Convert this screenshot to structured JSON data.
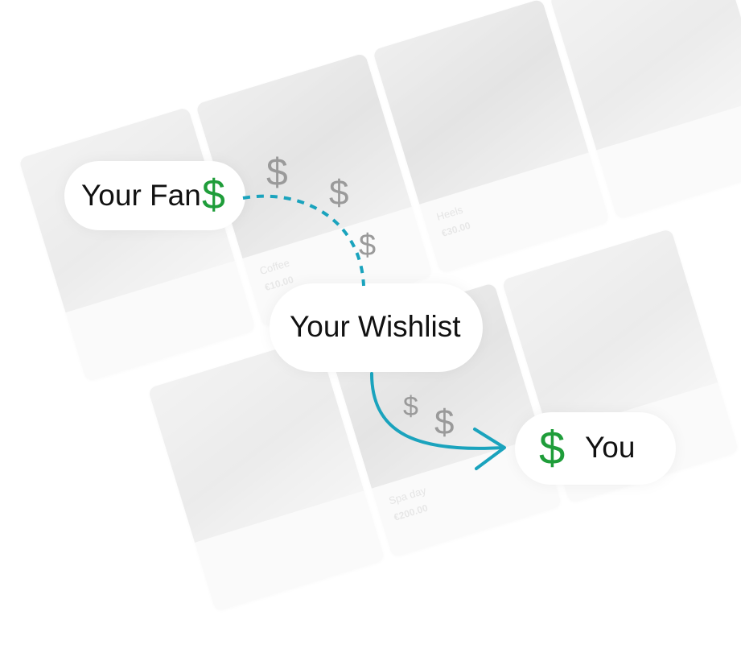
{
  "diagram": {
    "fan": {
      "label": "Your Fan",
      "dollar": "$"
    },
    "wishlist": {
      "label": "Your Wishlist"
    },
    "you": {
      "label": "You",
      "dollar": "$"
    },
    "floating_dollars": [
      "$",
      "$",
      "$",
      "$",
      "$"
    ],
    "colors": {
      "accent_path": "#1aa3bd",
      "dollar_green": "#1f9d3a",
      "dollar_grey": "#9a9a9a",
      "text": "#111111"
    }
  },
  "background_cards": [
    {
      "title": "",
      "price": ""
    },
    {
      "title": "Coffee",
      "price": "€10.00"
    },
    {
      "title": "Heels",
      "price": "€30.00"
    },
    {
      "title": "",
      "price": ""
    },
    {
      "title": "",
      "price": ""
    },
    {
      "title": "Spa day",
      "price": "€200.00"
    },
    {
      "title": "",
      "price": ""
    }
  ]
}
